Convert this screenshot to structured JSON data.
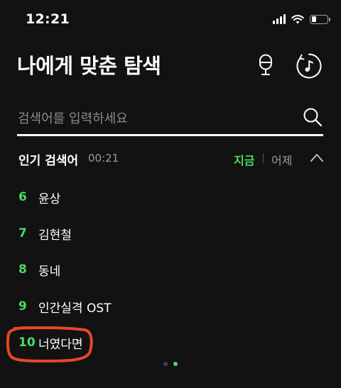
{
  "status_bar": {
    "time": "12:21"
  },
  "header": {
    "title": "나에게 맞춘 탐색",
    "mic_icon": "microphone-icon",
    "music_icon": "music-recognition-icon"
  },
  "search": {
    "placeholder": "검색어를 입력하세요",
    "value": "",
    "icon": "search-icon"
  },
  "popular": {
    "title": "인기 검색어",
    "time": "00:21",
    "tabs": [
      {
        "label": "지금",
        "active": true
      },
      {
        "label": "어제",
        "active": false
      }
    ],
    "collapse_icon": "chevron-up-icon",
    "items": [
      {
        "rank": "6",
        "label": "윤상"
      },
      {
        "rank": "7",
        "label": "김현철"
      },
      {
        "rank": "8",
        "label": "동네"
      },
      {
        "rank": "9",
        "label": "인간실격 OST"
      },
      {
        "rank": "10",
        "label": "너였다면"
      }
    ]
  },
  "pagination": {
    "pages": 2,
    "current": 2
  },
  "colors": {
    "background": "#121212",
    "accent": "#4cd964",
    "muted": "#9a9a9a",
    "annotation": "#e8452c"
  }
}
